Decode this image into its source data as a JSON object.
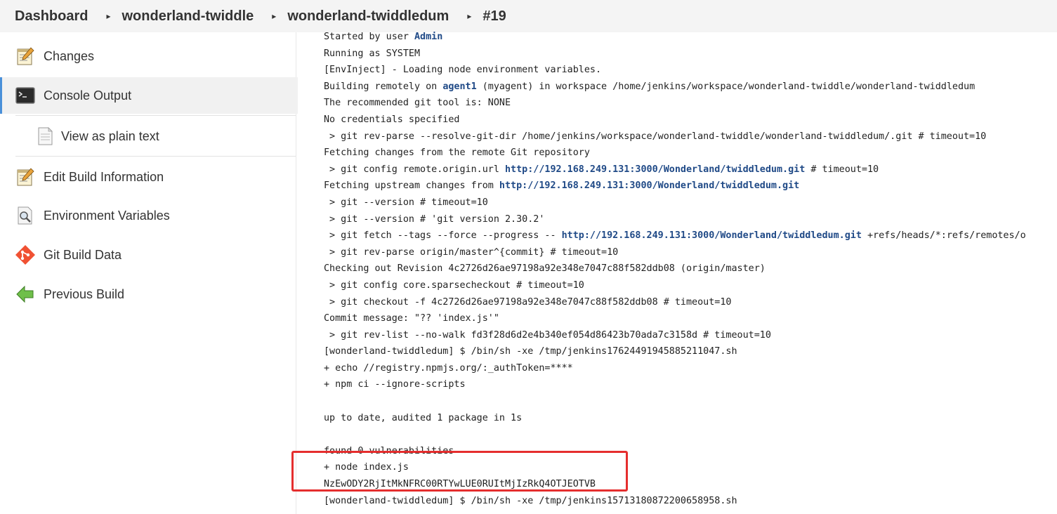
{
  "breadcrumb": {
    "items": [
      "Dashboard",
      "wonderland-twiddle",
      "wonderland-twiddledum",
      "#19"
    ],
    "separator": "▸"
  },
  "sidebar": {
    "items": [
      {
        "label": "Changes",
        "icon": "notepad-icon"
      },
      {
        "label": "Console Output",
        "icon": "terminal-icon"
      },
      {
        "label": "View as plain text",
        "icon": "document-icon"
      },
      {
        "label": "Edit Build Information",
        "icon": "notepad-icon"
      },
      {
        "label": "Environment Variables",
        "icon": "magnifier-icon"
      },
      {
        "label": "Git Build Data",
        "icon": "git-icon"
      },
      {
        "label": "Previous Build",
        "icon": "arrow-left-icon"
      }
    ],
    "active_index": 1
  },
  "console": {
    "lines": [
      {
        "parts": [
          {
            "t": "Started by user "
          },
          {
            "t": "Admin",
            "link": true
          }
        ]
      },
      {
        "parts": [
          {
            "t": "Running as SYSTEM"
          }
        ]
      },
      {
        "parts": [
          {
            "t": "[EnvInject] - Loading node environment variables."
          }
        ]
      },
      {
        "parts": [
          {
            "t": "Building remotely on "
          },
          {
            "t": "agent1",
            "link": true
          },
          {
            "t": " (myagent) in workspace /home/jenkins/workspace/wonderland-twiddle/wonderland-twiddledum"
          }
        ]
      },
      {
        "parts": [
          {
            "t": "The recommended git tool is: NONE"
          }
        ]
      },
      {
        "parts": [
          {
            "t": "No credentials specified"
          }
        ]
      },
      {
        "parts": [
          {
            "t": " > git rev-parse --resolve-git-dir /home/jenkins/workspace/wonderland-twiddle/wonderland-twiddledum/.git # timeout=10"
          }
        ]
      },
      {
        "parts": [
          {
            "t": "Fetching changes from the remote Git repository"
          }
        ]
      },
      {
        "parts": [
          {
            "t": " > git config remote.origin.url "
          },
          {
            "t": "http://192.168.249.131:3000/Wonderland/twiddledum.git",
            "link": true
          },
          {
            "t": " # timeout=10"
          }
        ]
      },
      {
        "parts": [
          {
            "t": "Fetching upstream changes from "
          },
          {
            "t": "http://192.168.249.131:3000/Wonderland/twiddledum.git",
            "link": true
          }
        ]
      },
      {
        "parts": [
          {
            "t": " > git --version # timeout=10"
          }
        ]
      },
      {
        "parts": [
          {
            "t": " > git --version # 'git version 2.30.2'"
          }
        ]
      },
      {
        "parts": [
          {
            "t": " > git fetch --tags --force --progress -- "
          },
          {
            "t": "http://192.168.249.131:3000/Wonderland/twiddledum.git",
            "link": true
          },
          {
            "t": " +refs/heads/*:refs/remotes/o"
          }
        ]
      },
      {
        "parts": [
          {
            "t": " > git rev-parse origin/master^{commit} # timeout=10"
          }
        ]
      },
      {
        "parts": [
          {
            "t": "Checking out Revision 4c2726d26ae97198a92e348e7047c88f582ddb08 (origin/master)"
          }
        ]
      },
      {
        "parts": [
          {
            "t": " > git config core.sparsecheckout # timeout=10"
          }
        ]
      },
      {
        "parts": [
          {
            "t": " > git checkout -f 4c2726d26ae97198a92e348e7047c88f582ddb08 # timeout=10"
          }
        ]
      },
      {
        "parts": [
          {
            "t": "Commit message: \"?? 'index.js'\""
          }
        ]
      },
      {
        "parts": [
          {
            "t": " > git rev-list --no-walk fd3f28d6d2e4b340ef054d86423b70ada7c3158d # timeout=10"
          }
        ]
      },
      {
        "parts": [
          {
            "t": "[wonderland-twiddledum] $ /bin/sh -xe /tmp/jenkins17624491945885211047.sh"
          }
        ]
      },
      {
        "parts": [
          {
            "t": "+ echo //registry.npmjs.org/:_authToken=****"
          }
        ]
      },
      {
        "parts": [
          {
            "t": "+ npm ci --ignore-scripts"
          }
        ]
      },
      {
        "parts": [
          {
            "t": ""
          }
        ]
      },
      {
        "parts": [
          {
            "t": "up to date, audited 1 package in 1s"
          }
        ]
      },
      {
        "parts": [
          {
            "t": ""
          }
        ]
      },
      {
        "parts": [
          {
            "t": "found 0 vulnerabilities"
          }
        ]
      },
      {
        "parts": [
          {
            "t": "+ node index.js"
          }
        ]
      },
      {
        "parts": [
          {
            "t": "NzEwODY2RjItMkNFRC00RTYwLUE0RUItMjIzRkQ4OTJEOTVB"
          }
        ]
      },
      {
        "parts": [
          {
            "t": "[wonderland-twiddledum] $ /bin/sh -xe /tmp/jenkins15713180872200658958.sh"
          }
        ]
      }
    ]
  },
  "colors": {
    "link": "#204a87",
    "highlight_box": "#e52e2e",
    "active_bar": "#4a90d9"
  }
}
